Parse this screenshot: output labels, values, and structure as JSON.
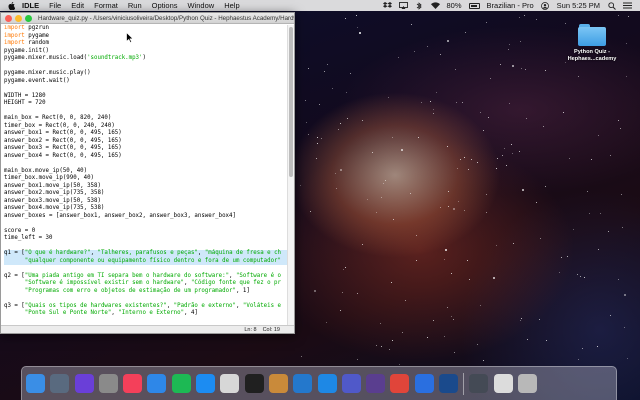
{
  "menubar": {
    "app_name": "IDLE",
    "menus": [
      "File",
      "Edit",
      "Format",
      "Run",
      "Options",
      "Window",
      "Help"
    ],
    "status": {
      "battery": "80%",
      "input_source": "Brazilian - Pro",
      "clock": "Sun 5:25 PM"
    }
  },
  "window": {
    "title": "Hardware_quiz.py - /Users/viniciusoliveira/Desktop/Python Quiz - Hephaestus Academy/Hardw...",
    "code_lines": [
      {
        "segments": [
          {
            "t": "import",
            "c": "kw"
          },
          {
            "t": " pgzrun"
          }
        ]
      },
      {
        "segments": [
          {
            "t": "import",
            "c": "kw"
          },
          {
            "t": " pygame"
          }
        ]
      },
      {
        "segments": [
          {
            "t": "import",
            "c": "kw"
          },
          {
            "t": " random"
          }
        ]
      },
      {
        "segments": [
          {
            "t": "pygame.init()"
          }
        ]
      },
      {
        "segments": [
          {
            "t": "pygame.mixer.music.load("
          },
          {
            "t": "'soundtrack.mp3'",
            "c": "str"
          },
          {
            "t": ")"
          }
        ]
      },
      {
        "segments": [
          {
            "t": ""
          }
        ]
      },
      {
        "segments": [
          {
            "t": "pygame.mixer.music.play()"
          }
        ]
      },
      {
        "segments": [
          {
            "t": "pygame.event.wait()"
          }
        ]
      },
      {
        "segments": [
          {
            "t": ""
          }
        ]
      },
      {
        "segments": [
          {
            "t": "WIDTH = 1280"
          }
        ]
      },
      {
        "segments": [
          {
            "t": "HEIGHT = 720"
          }
        ]
      },
      {
        "segments": [
          {
            "t": ""
          }
        ]
      },
      {
        "segments": [
          {
            "t": "main_box = Rect(0, 0, 820, 240)"
          }
        ]
      },
      {
        "segments": [
          {
            "t": "timer_box = Rect(0, 0, 240, 240)"
          }
        ]
      },
      {
        "segments": [
          {
            "t": "answer_box1 = Rect(0, 0, 495, 165)"
          }
        ]
      },
      {
        "segments": [
          {
            "t": "answer_box2 = Rect(0, 0, 495, 165)"
          }
        ]
      },
      {
        "segments": [
          {
            "t": "answer_box3 = Rect(0, 0, 495, 165)"
          }
        ]
      },
      {
        "segments": [
          {
            "t": "answer_box4 = Rect(0, 0, 495, 165)"
          }
        ]
      },
      {
        "segments": [
          {
            "t": ""
          }
        ]
      },
      {
        "segments": [
          {
            "t": "main_box.move_ip(50, 40)"
          }
        ]
      },
      {
        "segments": [
          {
            "t": "timer_box.move_ip(990, 40)"
          }
        ]
      },
      {
        "segments": [
          {
            "t": "answer_box1.move_ip(50, 358)"
          }
        ]
      },
      {
        "segments": [
          {
            "t": "answer_box2.move_ip(735, 358)"
          }
        ]
      },
      {
        "segments": [
          {
            "t": "answer_box3.move_ip(50, 538)"
          }
        ]
      },
      {
        "segments": [
          {
            "t": "answer_box4.move_ip(735, 538)"
          }
        ]
      },
      {
        "segments": [
          {
            "t": "answer_boxes = [answer_box1, answer_box2, answer_box3, answer_box4]"
          }
        ]
      },
      {
        "segments": [
          {
            "t": ""
          }
        ]
      },
      {
        "segments": [
          {
            "t": "score = 0"
          }
        ]
      },
      {
        "segments": [
          {
            "t": "time_left = 30"
          }
        ]
      },
      {
        "segments": [
          {
            "t": ""
          }
        ]
      },
      {
        "hl": true,
        "segments": [
          {
            "t": "q1 = ["
          },
          {
            "t": "\"O que é hardware?\"",
            "c": "str"
          },
          {
            "t": ", "
          },
          {
            "t": "\"Talheres, parafusos e peças\"",
            "c": "str"
          },
          {
            "t": ", "
          },
          {
            "t": "\"máquina de fresa e ch",
            "c": "str"
          }
        ]
      },
      {
        "hl": true,
        "segments": [
          {
            "t": "      "
          },
          {
            "t": "\"qualquer componente ou equipamento físico dentro e fora de um computador\"",
            "c": "str"
          }
        ]
      },
      {
        "segments": [
          {
            "t": ""
          }
        ]
      },
      {
        "segments": [
          {
            "t": "q2 = ["
          },
          {
            "t": "\"Uma piada antigo em TI separa bem o hardware do software:\"",
            "c": "str"
          },
          {
            "t": ", "
          },
          {
            "t": "\"Software é o",
            "c": "str"
          }
        ]
      },
      {
        "segments": [
          {
            "t": "      "
          },
          {
            "t": "\"Software é impossível existir sem o hardware\"",
            "c": "str"
          },
          {
            "t": ", "
          },
          {
            "t": "\"Código fonte que fez o pr",
            "c": "str"
          }
        ]
      },
      {
        "segments": [
          {
            "t": "      "
          },
          {
            "t": "\"Programas com erro e objetos de estimação de um programador\"",
            "c": "str"
          },
          {
            "t": ", 1]"
          }
        ]
      },
      {
        "segments": [
          {
            "t": ""
          }
        ]
      },
      {
        "segments": [
          {
            "t": "q3 = ["
          },
          {
            "t": "\"Quais os tipos de hardwares existentes?\"",
            "c": "str"
          },
          {
            "t": ", "
          },
          {
            "t": "\"Padrão e externo\"",
            "c": "str"
          },
          {
            "t": ", "
          },
          {
            "t": "\"Voláteis e",
            "c": "str"
          }
        ]
      },
      {
        "segments": [
          {
            "t": "      "
          },
          {
            "t": "\"Ponte Sul e Ponte Norte\"",
            "c": "str"
          },
          {
            "t": ", "
          },
          {
            "t": "\"Interno e Externo\"",
            "c": "str"
          },
          {
            "t": ", 4]"
          }
        ]
      }
    ],
    "status_line": "Ln: 8",
    "status_col": "Col: 19"
  },
  "desktop_icon": {
    "label_line1": "Python Quiz -",
    "label_line2": "Hephaes...cademy"
  },
  "dock": [
    {
      "name": "finder-icon",
      "color": "#3a8ee6"
    },
    {
      "name": "launchpad-icon",
      "color": "#596a7f"
    },
    {
      "name": "siri-icon",
      "color": "#6a3fd8"
    },
    {
      "name": "system-preferences-icon",
      "color": "#8a8a8a"
    },
    {
      "name": "music-icon",
      "color": "#f4405a"
    },
    {
      "name": "safari-icon",
      "color": "#2e87e8"
    },
    {
      "name": "spotify-icon",
      "color": "#1db954"
    },
    {
      "name": "app-store-icon",
      "color": "#1c8cf2"
    },
    {
      "name": "python-launcher-icon",
      "color": "#d7d7d7"
    },
    {
      "name": "terminal-icon",
      "color": "#202020"
    },
    {
      "name": "preview-icon",
      "color": "#c98a3a"
    },
    {
      "name": "visual-studio-code-icon",
      "color": "#2478cc"
    },
    {
      "name": "checkmark-app-icon",
      "color": "#1e88e5"
    },
    {
      "name": "teams-icon",
      "color": "#5059c9"
    },
    {
      "name": "github-desktop-icon",
      "color": "#5a3e8f"
    },
    {
      "name": "chrome-icon",
      "color": "#e0453a"
    },
    {
      "name": "firefox-icon",
      "color": "#2a6fe0"
    },
    {
      "name": "quicktime-icon",
      "color": "#1a4a8c"
    },
    {
      "name": "keyboard-viewer-icon",
      "color": "#444a55"
    },
    {
      "name": "screenshot-icon",
      "color": "#dcdcdc"
    },
    {
      "name": "trash-icon",
      "color": "#b8b8b8"
    }
  ]
}
